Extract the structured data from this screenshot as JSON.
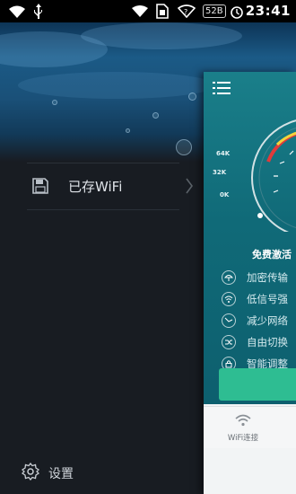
{
  "status_bar": {
    "time": "23:41",
    "battery_badge": "52B",
    "icons": [
      "wifi-icon",
      "usb-icon",
      "wifi-icon",
      "sim-card-icon",
      "wifi-question-icon",
      "alarm-icon"
    ]
  },
  "drawer": {
    "saved_wifi_label": "已存WiFi",
    "settings_label": "设置"
  },
  "main_panel": {
    "gauge_ticks": [
      "64K",
      "32K",
      "0K"
    ],
    "free_activation_title": "免费激活",
    "features": [
      "加密传输",
      "低信号强",
      "减少网络",
      "自由切换",
      "智能调整"
    ],
    "tab_wifi_label": "WiFi连接"
  },
  "colors": {
    "accent_green": "#2ebd92",
    "panel_teal": "#106a78",
    "gauge_red": "#e23b3b",
    "gauge_yellow": "#f3d23a"
  }
}
